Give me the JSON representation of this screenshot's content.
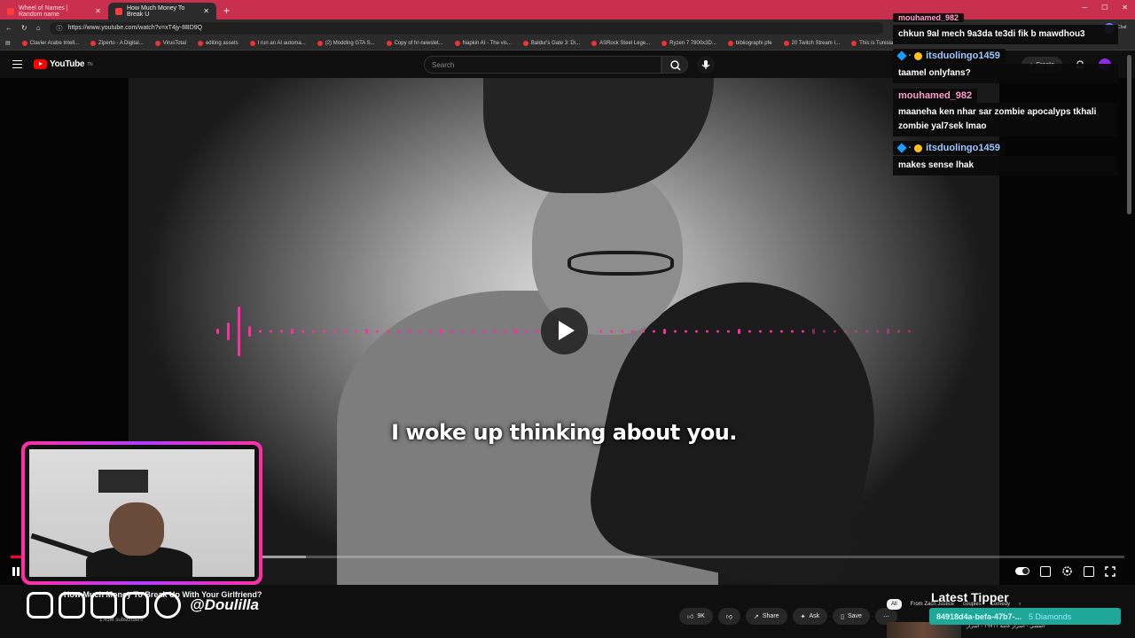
{
  "browser": {
    "tabs": [
      {
        "title": "Wheel of Names | Random name"
      },
      {
        "title": "How Much Money To Break U"
      }
    ],
    "url": "https://www.youtube.com/watch?v=xT4jy-8BD9Q",
    "bookmarks": [
      "Clavier Arabe Intell...",
      "Ziperto - A Digital...",
      "VirusTotal",
      "editing assets",
      "I run an AI automa...",
      "(2) Modding GTA S...",
      "Copy of hr-newslet...",
      "Napkin AI - The vis...",
      "Baldur's Gate 3: Di...",
      "ASRock Steel Lege...",
      "Ryzen 7 7800x3D...",
      "bibliographi pfe",
      "20 Twitch Stream I...",
      "This is Tunisia..."
    ]
  },
  "youtube": {
    "logo": "YouTube",
    "logo_sup": "TN",
    "search_placeholder": "Search",
    "create_label": "Create"
  },
  "video": {
    "caption": "I woke up thinking about you.",
    "progress_fraction": 0.025,
    "buffer_fraction": 0.265
  },
  "below": {
    "title": "How Much Money To Break Up With Your Girlfriend?",
    "subs": "1.43M subscribers",
    "likes": "9K",
    "share": "Share",
    "ask": "Ask",
    "save": "Save",
    "chips": [
      "All",
      "From Zach Justice",
      "couples",
      "Comedy"
    ]
  },
  "overlay": {
    "handle": "@Doulilla",
    "latest_tipper_label": "Latest Tipper",
    "tipper_name": "84918d4a-befa-47b7-...",
    "tipper_amount": "5 Diamonds",
    "reco_text": "المشي - اسرار عامة ١٩٧١١ - اسرار"
  },
  "chat": {
    "label": "Chat",
    "messages": [
      {
        "user": "mouhamed_982",
        "text": "chkun 9al mech 9a3da te3di fik b mawdhou3",
        "style": "pink"
      },
      {
        "user": "itsduolingo1459",
        "text": "taamel onlyfans?",
        "style": "blue"
      },
      {
        "user": "mouhamed_982",
        "text": "maaneha ken nhar sar zombie apocalyps tkhali zombie yal7sek lmao",
        "style": "pink"
      },
      {
        "user": "itsduolingo1459",
        "text": "makes sense lhak",
        "style": "blue"
      }
    ]
  },
  "colors": {
    "accent_pink": "#ff2fa3",
    "youtube_red": "#ff0000",
    "tipper_bg": "#1fa89a"
  }
}
